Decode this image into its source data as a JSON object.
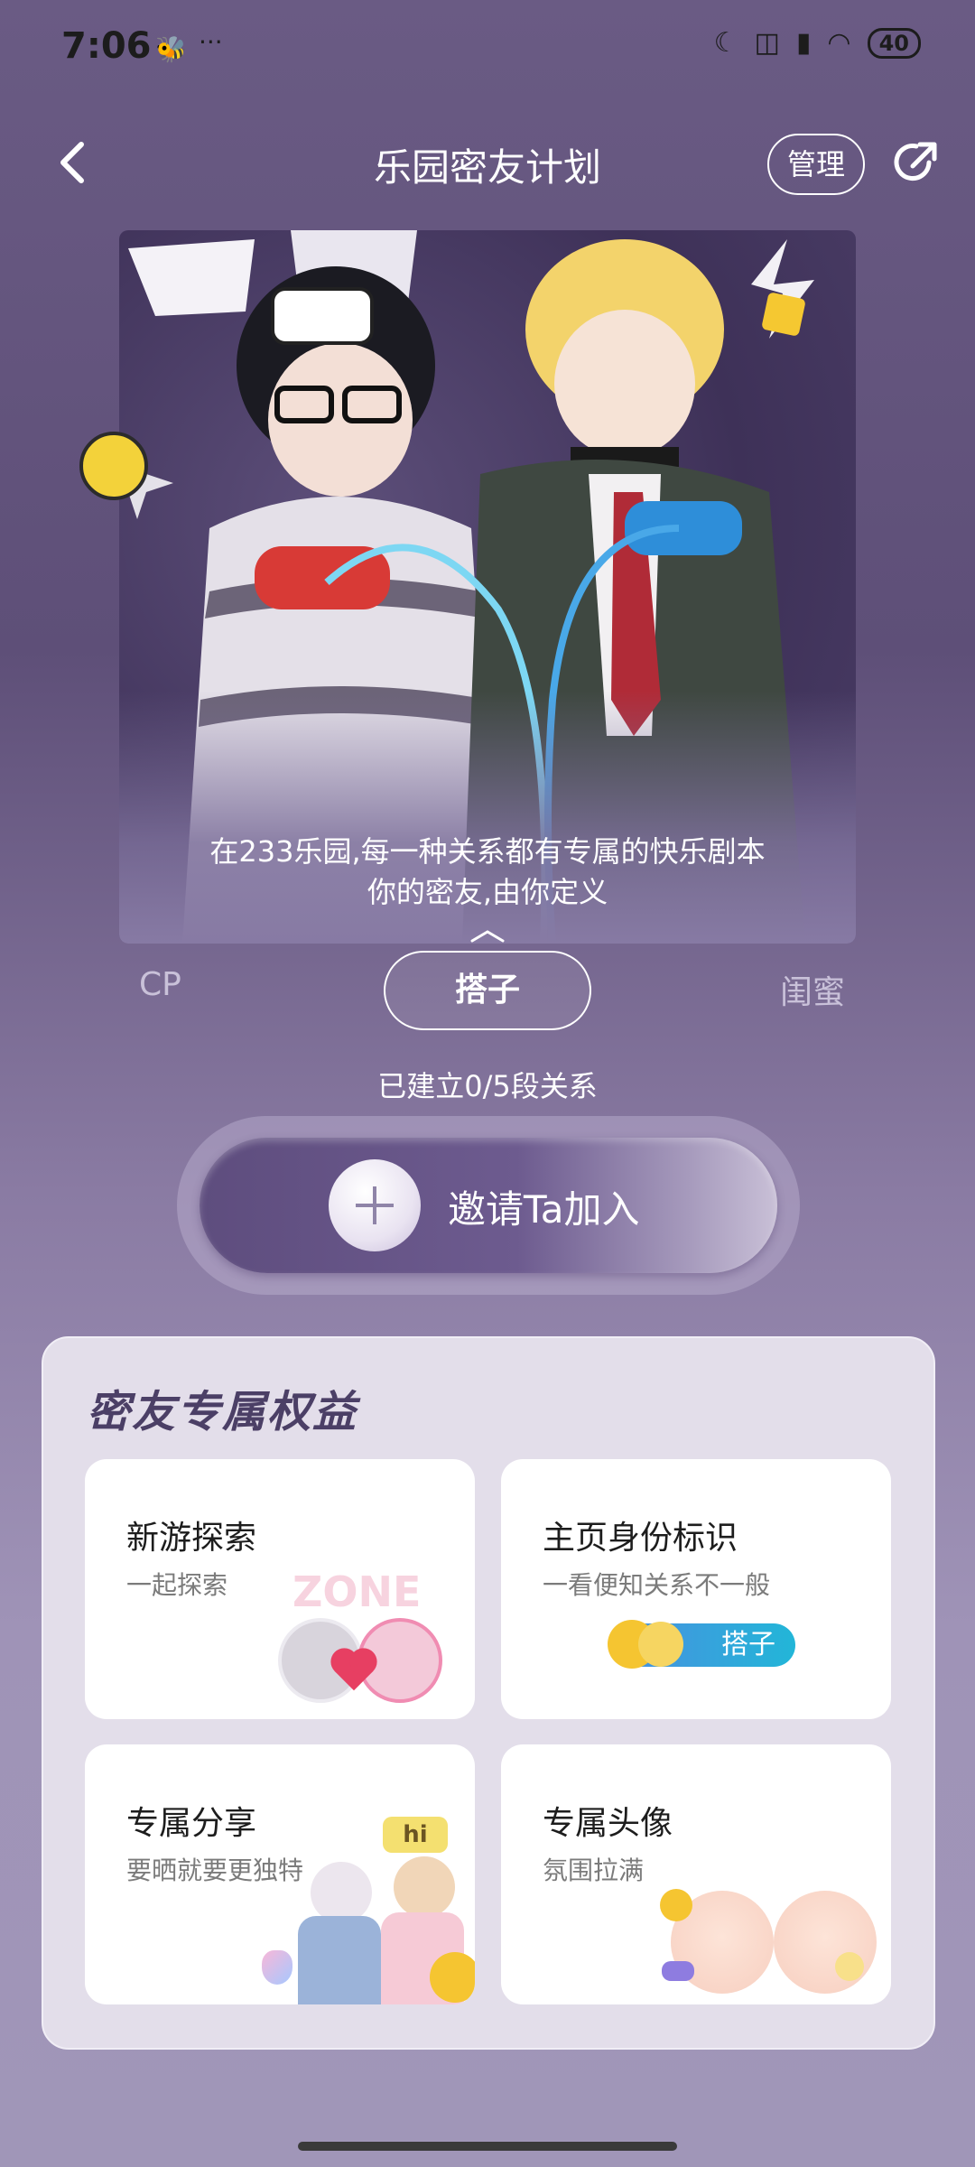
{
  "status_bar": {
    "time": "7:06",
    "battery": "40",
    "icons": [
      "bee-icon",
      "more-dots-icon",
      "moon-icon",
      "notification-icon",
      "signal-icon",
      "wifi-icon",
      "battery-icon"
    ]
  },
  "header": {
    "title": "乐园密友计划",
    "manage_label": "管理"
  },
  "hero": {
    "line1": "在233乐园,每一种关系都有专属的快乐剧本",
    "line2": "你的密友,由你定义"
  },
  "tabs": {
    "left": "CP",
    "active": "搭子",
    "right": "闺蜜"
  },
  "relation_count": "已建立0/5段关系",
  "invite": {
    "label": "邀请Ta加入"
  },
  "benefits": {
    "title": "密友专属权益",
    "items": [
      {
        "title": "新游探索",
        "subtitle": "一起探索",
        "decor_text": "ZONE"
      },
      {
        "title": "主页身份标识",
        "subtitle": "一看便知关系不一般",
        "tag": "搭子"
      },
      {
        "title": "专属分享",
        "subtitle": "要晒就要更独特",
        "bubble": "hi"
      },
      {
        "title": "专属头像",
        "subtitle": "氛围拉满"
      }
    ]
  },
  "colors": {
    "background": "#6a5b84",
    "benefits_bg": "#e3deea",
    "benefits_title": "#4b3f66",
    "tag_blue": "#3a9ee0",
    "heart": "#e73f62"
  }
}
